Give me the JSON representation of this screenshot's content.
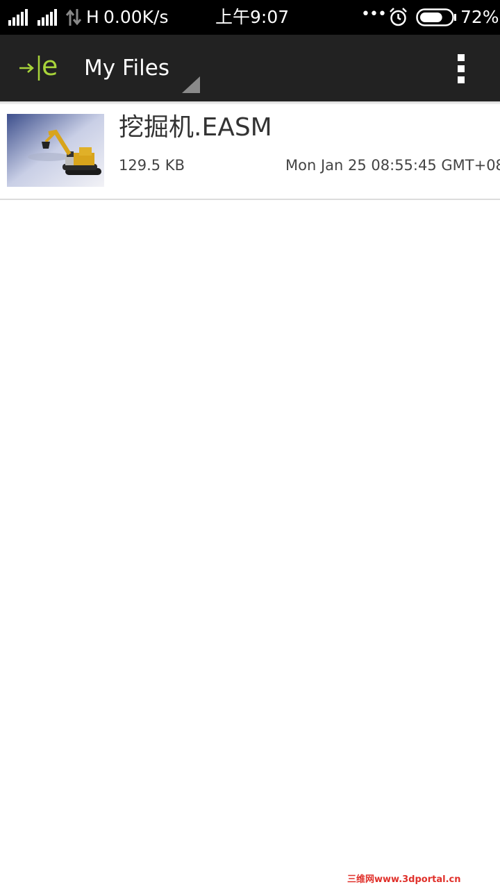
{
  "status_bar": {
    "network": "H",
    "speed": "0.00K/s",
    "time": "上午9:07",
    "battery_percent": "72%",
    "battery_level": 0.72,
    "more_indicator": "•••",
    "icons": [
      "signal-1-icon",
      "signal-2-icon",
      "data-arrows-icon",
      "alarm-icon",
      "battery-icon"
    ]
  },
  "action_bar": {
    "title": "My Files",
    "logo_text": "e",
    "icons": [
      "app-logo",
      "spinner-triangle-icon",
      "overflow-menu-icon"
    ]
  },
  "files": [
    {
      "name": "挖掘机.EASM",
      "size": "129.5 KB",
      "date": "Mon Jan 25 08:55:45 GMT+08",
      "thumbnail": "excavator-thumbnail"
    }
  ],
  "watermark": {
    "text": "三维网www.3dportal.cn"
  },
  "colors": {
    "status_bar_bg": "#000000",
    "action_bar_bg": "#222222",
    "logo_green": "#a8d43a",
    "text_primary": "#333333",
    "watermark_red": "#e0302a"
  }
}
